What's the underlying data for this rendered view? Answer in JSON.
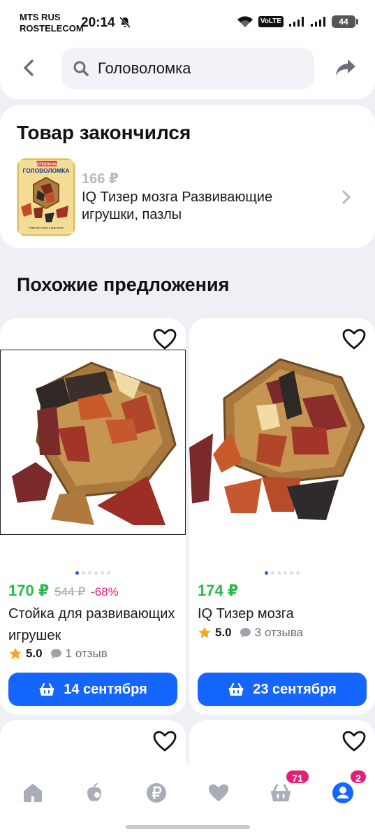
{
  "status_bar": {
    "carrier_line1": "MTS RUS",
    "carrier_line2": "ROSTELECOM",
    "time": "20:14",
    "volte": "VoLTE",
    "battery": "44"
  },
  "header": {
    "search_value": "Головоломка"
  },
  "out_of_stock": {
    "title": "Товар закончился",
    "price": "166 ₽",
    "name": "IQ Тизер мозга Развивающие игрушки, пазлы",
    "thumb_top_text": "ДЕРЕВЯННАЯ",
    "thumb_title": "ГОЛОВОЛОМКА",
    "thumb_bottom_text": "Развитие логики и мышления"
  },
  "similar": {
    "title": "Похожие предложения",
    "products": [
      {
        "price": "170 ₽",
        "old_price": "544 ₽",
        "discount": "-68%",
        "name": "Стойка для развивающих игрушек",
        "rating": "5.0",
        "reviews": "1 отзыв",
        "delivery": "14 сентября"
      },
      {
        "price": "174 ₽",
        "old_price": "",
        "discount": "",
        "name": "IQ Тизер мозга",
        "rating": "5.0",
        "reviews": "3 отзыва",
        "delivery": "23 сентября"
      }
    ]
  },
  "bottom_nav": {
    "cart_badge": "71",
    "profile_badge": "2"
  },
  "colors": {
    "accent": "#1466ff",
    "price_green": "#2bb84a",
    "discount_pink": "#e61e75"
  }
}
